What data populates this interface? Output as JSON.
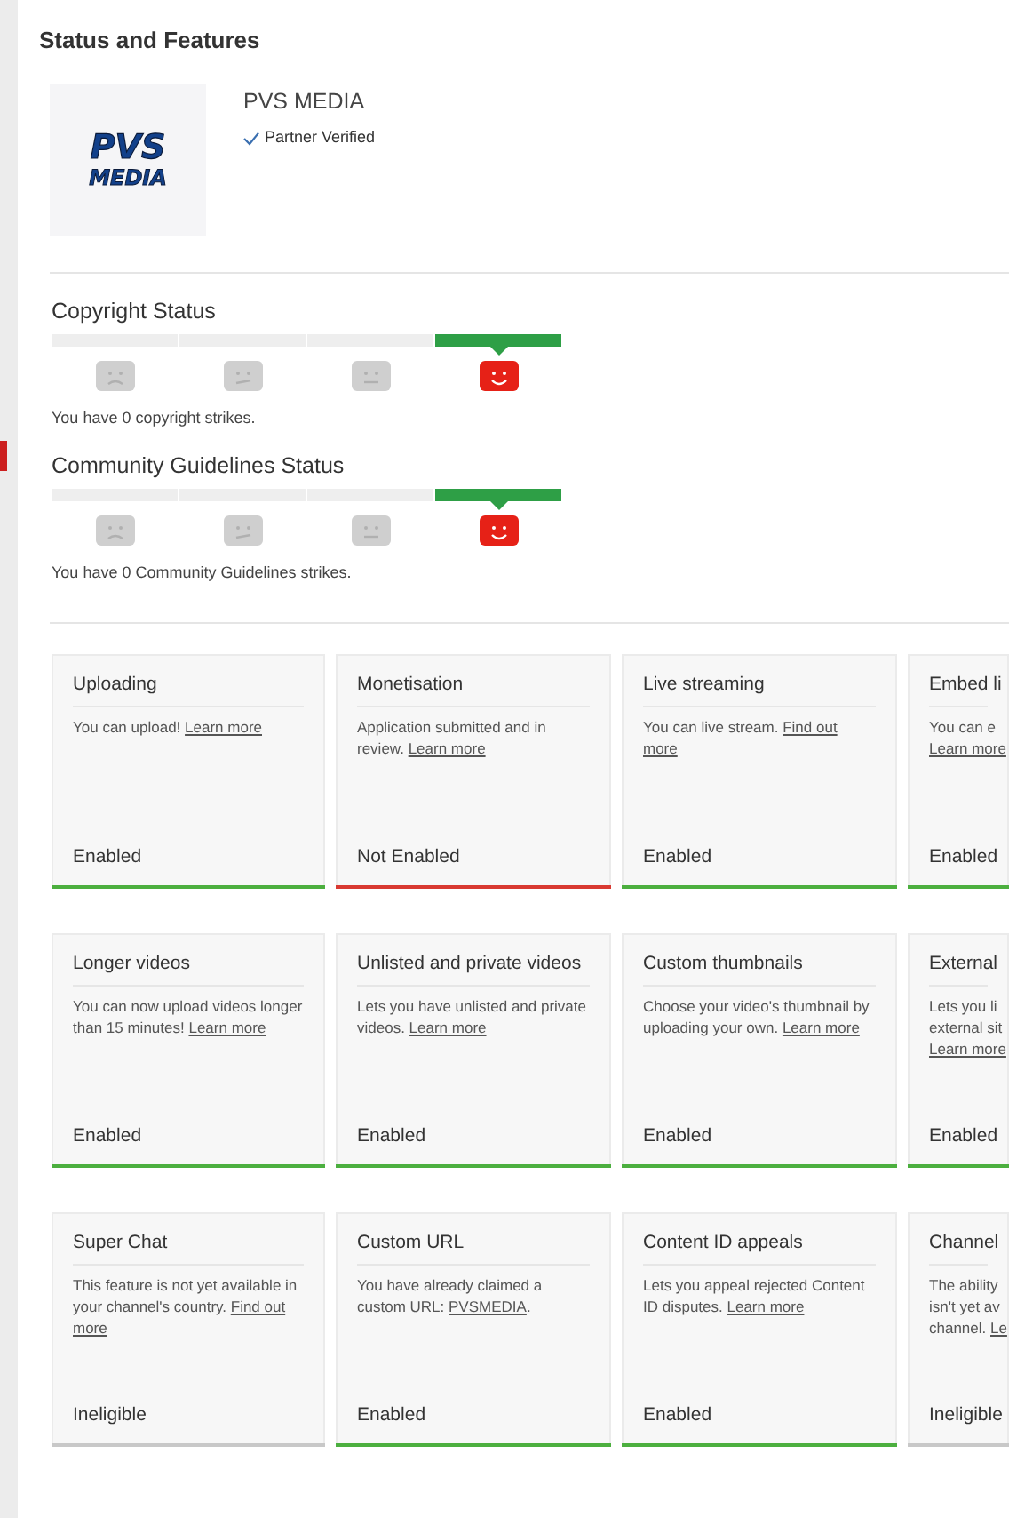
{
  "page": {
    "title": "Status and Features"
  },
  "channel": {
    "logo": [
      "PVS",
      "MEDIA"
    ],
    "name": "PVS MEDIA",
    "badge": "Partner Verified"
  },
  "statuses": [
    {
      "title": "Copyright Status",
      "faces": [
        {
          "kind": "sad",
          "selected": false
        },
        {
          "kind": "uneasy",
          "selected": false
        },
        {
          "kind": "neutral",
          "selected": false
        },
        {
          "kind": "happy",
          "selected": true
        }
      ],
      "message": "You have 0 copyright strikes."
    },
    {
      "title": "Community Guidelines Status",
      "faces": [
        {
          "kind": "sad",
          "selected": false
        },
        {
          "kind": "uneasy",
          "selected": false
        },
        {
          "kind": "neutral",
          "selected": false
        },
        {
          "kind": "happy",
          "selected": true
        }
      ],
      "message": "You have 0 Community Guidelines strikes."
    }
  ],
  "features": [
    {
      "title": "Uploading",
      "lines": [
        [
          {
            "text": "You can upload! "
          },
          {
            "text": "Learn more",
            "link": true
          }
        ]
      ],
      "status": "Enabled",
      "color": "#4caf3f"
    },
    {
      "title": "Monetisation",
      "lines": [
        [
          {
            "text": "Application submitted and in"
          }
        ],
        [
          {
            "text": "review. "
          },
          {
            "text": "Learn more",
            "link": true
          }
        ]
      ],
      "status": "Not Enabled",
      "color": "#d93a32"
    },
    {
      "title": "Live streaming",
      "lines": [
        [
          {
            "text": "You can live stream. "
          },
          {
            "text": "Find out",
            "link": true
          }
        ],
        [
          {
            "text": "more",
            "link": true
          }
        ]
      ],
      "status": "Enabled",
      "color": "#4caf3f"
    },
    {
      "title": "Embed li",
      "lines": [
        [
          {
            "text": "You can e"
          }
        ],
        [
          {
            "text": "Learn more",
            "link": true
          }
        ]
      ],
      "status": "Enabled",
      "color": "#4caf3f"
    },
    {
      "title": "Longer videos",
      "lines": [
        [
          {
            "text": "You can now upload videos longer"
          }
        ],
        [
          {
            "text": "than 15 minutes! "
          },
          {
            "text": "Learn more",
            "link": true
          }
        ]
      ],
      "status": "Enabled",
      "color": "#4caf3f"
    },
    {
      "title": "Unlisted and private videos",
      "lines": [
        [
          {
            "text": "Lets you have unlisted and private"
          }
        ],
        [
          {
            "text": "videos. "
          },
          {
            "text": "Learn more",
            "link": true
          }
        ]
      ],
      "status": "Enabled",
      "color": "#4caf3f"
    },
    {
      "title": "Custom thumbnails",
      "lines": [
        [
          {
            "text": "Choose your video's thumbnail by"
          }
        ],
        [
          {
            "text": "uploading your own. "
          },
          {
            "text": "Learn more",
            "link": true
          }
        ]
      ],
      "status": "Enabled",
      "color": "#4caf3f"
    },
    {
      "title": "External",
      "lines": [
        [
          {
            "text": "Lets you li"
          }
        ],
        [
          {
            "text": "external sit"
          }
        ],
        [
          {
            "text": "Learn more",
            "link": true
          }
        ]
      ],
      "status": "Enabled",
      "color": "#4caf3f"
    },
    {
      "title": "Super Chat",
      "lines": [
        [
          {
            "text": "This feature is not yet available in"
          }
        ],
        [
          {
            "text": "your channel's country. "
          },
          {
            "text": "Find out",
            "link": true
          }
        ],
        [
          {
            "text": "more",
            "link": true
          }
        ]
      ],
      "status": "Ineligible",
      "color": "#c8c8c8"
    },
    {
      "title": "Custom URL",
      "lines": [
        [
          {
            "text": "You have already claimed a"
          }
        ],
        [
          {
            "text": "custom URL: "
          },
          {
            "text": "PVSMEDIA",
            "link": true
          },
          {
            "text": "."
          }
        ]
      ],
      "status": "Enabled",
      "color": "#4caf3f"
    },
    {
      "title": "Content ID appeals",
      "lines": [
        [
          {
            "text": "Lets you appeal rejected Content"
          }
        ],
        [
          {
            "text": "ID disputes. "
          },
          {
            "text": "Learn more",
            "link": true
          }
        ]
      ],
      "status": "Enabled",
      "color": "#4caf3f"
    },
    {
      "title": "Channel",
      "lines": [
        [
          {
            "text": "The ability"
          }
        ],
        [
          {
            "text": "isn't yet av"
          }
        ],
        [
          {
            "text": "channel. "
          },
          {
            "text": "Le",
            "link": true
          }
        ]
      ],
      "status": "Ineligible",
      "color": "#c8c8c8"
    }
  ]
}
